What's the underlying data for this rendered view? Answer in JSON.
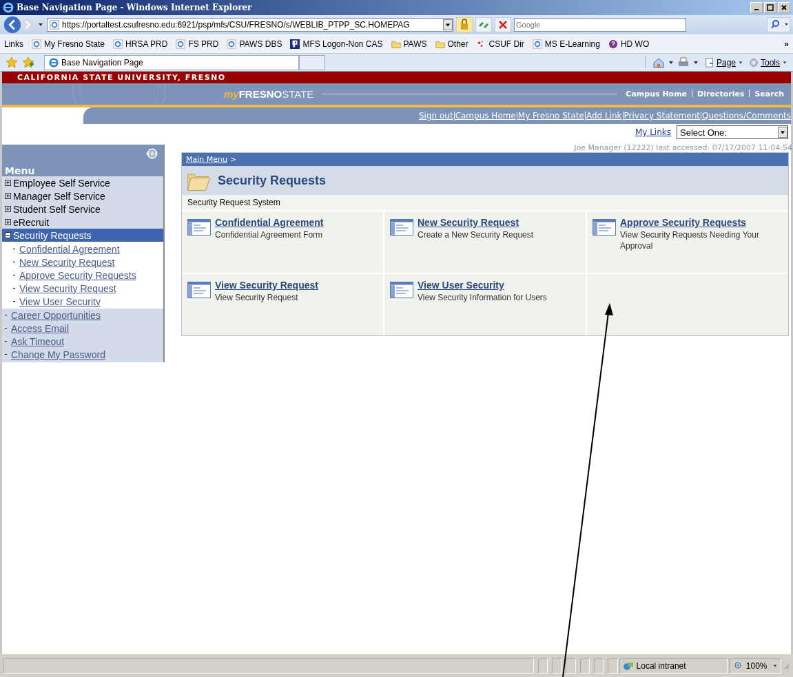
{
  "window": {
    "title": "Base Navigation Page - Windows Internet Explorer"
  },
  "address_bar": {
    "url": "https://portaltest.csufresno.edu:6921/psp/mfs/CSU/FRESNO/s/WEBLIB_PTPP_SC.HOMEPAG",
    "search_placeholder": "Google"
  },
  "links_bar": {
    "label": "Links",
    "items": [
      {
        "label": "My Fresno State",
        "kind": "ie"
      },
      {
        "label": "HRSA PRD",
        "kind": "ie"
      },
      {
        "label": "FS PRD",
        "kind": "ie"
      },
      {
        "label": "PAWS DBS",
        "kind": "ie"
      },
      {
        "label": "MFS Logon-Non CAS",
        "kind": "p"
      },
      {
        "label": "PAWS",
        "kind": "folder"
      },
      {
        "label": "Other",
        "kind": "folder"
      },
      {
        "label": "CSUF Dir",
        "kind": "dots"
      },
      {
        "label": "MS E-Learning",
        "kind": "ie"
      },
      {
        "label": "HD WO",
        "kind": "help"
      }
    ],
    "overflow": "»"
  },
  "tab": {
    "title": "Base Navigation Page"
  },
  "command_bar": {
    "page": "Page",
    "tools": "Tools"
  },
  "portal": {
    "university": "CALIFORNIA STATE UNIVERSITY, FRESNO",
    "logo_my": "my",
    "logo_fresno": "FRESNO",
    "logo_state": "STATE",
    "top_links": [
      "Campus Home",
      "Directories",
      "Search"
    ],
    "nav_links": [
      "Sign out",
      "Campus Home",
      "My Fresno State",
      "Add Link",
      "Privacy Statement",
      "Questions/Comments"
    ],
    "my_links": "My Links",
    "select_value": "Select One:",
    "last_accessed": "Joe Manager (12222) last accessed: 07/17/2007 11:04:54"
  },
  "menu": {
    "title": "Menu",
    "items": [
      {
        "label": "Employee Self Service",
        "kind": "folder",
        "expanded": false,
        "selected": false
      },
      {
        "label": "Manager Self Service",
        "kind": "folder",
        "expanded": false,
        "selected": false
      },
      {
        "label": "Student Self Service",
        "kind": "folder",
        "expanded": false,
        "selected": false
      },
      {
        "label": "eRecruit",
        "kind": "folder",
        "expanded": false,
        "selected": false
      },
      {
        "label": "Security Requests",
        "kind": "folder",
        "expanded": true,
        "selected": true,
        "children": [
          {
            "label": "Confidential Agreement"
          },
          {
            "label": "New Security Request"
          },
          {
            "label": "Approve Security Requests"
          },
          {
            "label": "View Security Request"
          },
          {
            "label": "View User Security"
          }
        ]
      },
      {
        "label": "Career Opportunities",
        "kind": "link",
        "selected": false
      },
      {
        "label": "Access Email",
        "kind": "link",
        "selected": false
      },
      {
        "label": "Ask Timeout",
        "kind": "link",
        "selected": false
      },
      {
        "label": "Change My Password",
        "kind": "link",
        "selected": false
      }
    ]
  },
  "content": {
    "breadcrumb": "Main Menu",
    "breadcrumb_sep": ">",
    "title": "Security Requests",
    "subtitle": "Security Request System",
    "tiles": [
      {
        "title": "Confidential Agreement",
        "description": "Confidential Agreement Form"
      },
      {
        "title": "New Security Request",
        "description": "Create a New Security Request"
      },
      {
        "title": "Approve Security Requests",
        "description": "View Security Requests Needing Your Approval"
      },
      {
        "title": "View Security Request",
        "description": "View Security Request"
      },
      {
        "title": "View User Security",
        "description": "View Security Information for Users"
      }
    ]
  },
  "status_bar": {
    "zone": "Local intranet",
    "zoom": "100%"
  }
}
